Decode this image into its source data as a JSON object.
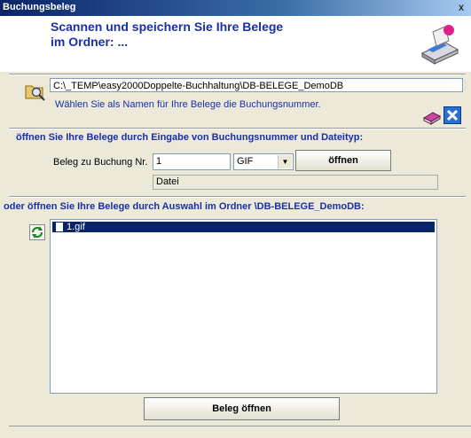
{
  "window": {
    "title": "Buchungsbeleg",
    "close_label": "x"
  },
  "header": {
    "headline_line1": "Scannen und speichern Sie Ihre Belege",
    "headline_line2": "im Ordner: ..."
  },
  "folder": {
    "path": "C:\\_TEMP\\easy2000Doppelte-Buchhaltung\\DB-BELEGE_DemoDB",
    "hint": "Wählen Sie als Namen für Ihre Belege die Buchungsnummer."
  },
  "section_by_number": {
    "heading": "öffnen Sie Ihre Belege durch Eingabe von Buchungsnummer und Dateityp:",
    "label": "Beleg zu Buchung Nr.",
    "number_value": "1",
    "filetype_selected": "GIF",
    "open_button": "öffnen",
    "file_field": "Datei"
  },
  "section_by_list": {
    "heading": "oder öffnen Sie Ihre Belege durch Auswahl im Ordner \\DB-BELEGE_DemoDB:",
    "files": [
      "1.gif"
    ],
    "open_button": "Beleg öffnen"
  },
  "colors": {
    "heading_blue": "#1a2faa",
    "selection": "#0a246a",
    "window_bg": "#ece9d8"
  }
}
